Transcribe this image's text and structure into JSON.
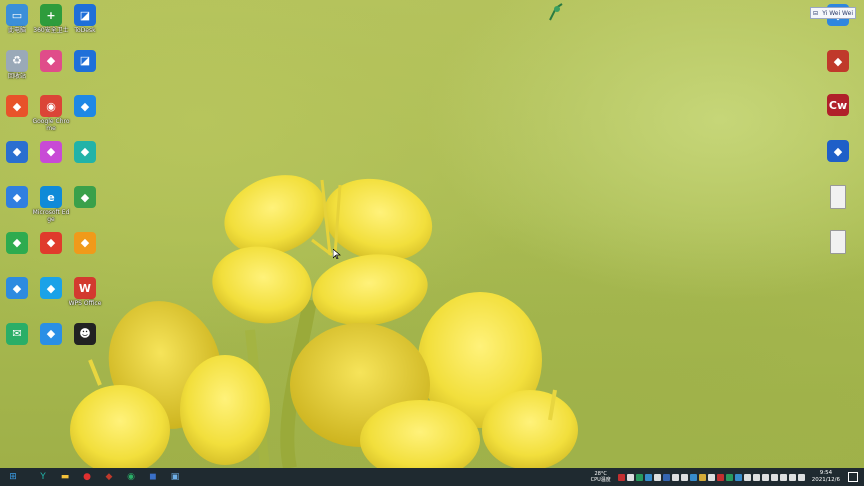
{
  "desktop_icons_left": [
    {
      "label": "此电脑",
      "icon": "computer-icon",
      "color": "#3b8fd9"
    },
    {
      "label": "360安全卫士",
      "icon": "360-guard-icon",
      "color": "#2e9c3c"
    },
    {
      "label": "ToDesk",
      "icon": "todesk-icon",
      "color": "#1e6fd9"
    },
    {
      "label": "回收站",
      "icon": "recycle-bin-icon",
      "color": "#9aa9b8"
    },
    {
      "label": "",
      "icon": "app-icon",
      "color": "#e04c8a"
    },
    {
      "label": "",
      "icon": "todesk-icon",
      "color": "#1e6fd9"
    },
    {
      "label": "",
      "icon": "app-icon",
      "color": "#e8532a"
    },
    {
      "label": "Google Chrome",
      "icon": "chrome-icon",
      "color": "#db4437"
    },
    {
      "label": "",
      "icon": "app-icon",
      "color": "#1e88e5"
    },
    {
      "label": "",
      "icon": "app-icon",
      "color": "#2a6fd0"
    },
    {
      "label": "",
      "icon": "app-icon",
      "color": "#c84ad6"
    },
    {
      "label": "",
      "icon": "app-icon",
      "color": "#22b3a8"
    },
    {
      "label": "",
      "icon": "app-icon",
      "color": "#2f7fe0"
    },
    {
      "label": "Microsoft Edge",
      "icon": "edge-icon",
      "color": "#0f8ad8"
    },
    {
      "label": "",
      "icon": "app-icon",
      "color": "#3aa04a"
    },
    {
      "label": "",
      "icon": "app-icon",
      "color": "#2eab4f"
    },
    {
      "label": "",
      "icon": "app-icon",
      "color": "#e03b2c"
    },
    {
      "label": "",
      "icon": "app-icon",
      "color": "#f09a1a"
    },
    {
      "label": "",
      "icon": "app-icon",
      "color": "#2d8be0"
    },
    {
      "label": "",
      "icon": "app-icon",
      "color": "#1aa2e8"
    },
    {
      "label": "WPS Office",
      "icon": "wps-icon",
      "color": "#d33a2f"
    },
    {
      "label": "",
      "icon": "wechat-icon",
      "color": "#2aae67"
    },
    {
      "label": "",
      "icon": "app-icon",
      "color": "#2a8fe6"
    },
    {
      "label": "",
      "icon": "qq-icon",
      "color": "#222222"
    }
  ],
  "desktop_icons_right": [
    {
      "label": "",
      "icon": "app-icon",
      "color": "#2e86de"
    },
    {
      "label": "",
      "icon": "app-icon",
      "color": "#c0392b"
    },
    {
      "label": "",
      "icon": "capswriter-icon",
      "color": "#b0202a"
    },
    {
      "label": "",
      "icon": "app-icon",
      "color": "#1f5fc8"
    },
    {
      "label": "",
      "icon": "file-icon",
      "color": "#f1f1f1"
    },
    {
      "label": "",
      "icon": "file-icon",
      "color": "#f1f1f1"
    }
  ],
  "tray_widget": {
    "label": "Yi Wei Wei",
    "icon": "widget-icon"
  },
  "taskbar": {
    "buttons": [
      {
        "name": "start-button",
        "glyph": "⊞",
        "color": "#3c9ee8"
      },
      {
        "name": "taskbar-app-1",
        "glyph": "Y",
        "color": "#22b3a8"
      },
      {
        "name": "taskbar-explorer",
        "glyph": "▬",
        "color": "#f3c13a"
      },
      {
        "name": "taskbar-app-2",
        "glyph": "●",
        "color": "#e03030"
      },
      {
        "name": "taskbar-app-3",
        "glyph": "◆",
        "color": "#c0392b"
      },
      {
        "name": "taskbar-wechat",
        "glyph": "◉",
        "color": "#2aae67"
      },
      {
        "name": "taskbar-app-4",
        "glyph": "◼",
        "color": "#3a70c8"
      },
      {
        "name": "taskbar-app-5",
        "glyph": "▣",
        "color": "#6fb0e8"
      }
    ],
    "weather_temp": "28°C",
    "weather_label": "CPU温度",
    "clock_time": "9:54",
    "clock_date": "2021/12/6",
    "tray_colors": [
      "#e03030",
      "#ffffff",
      "#2aae67",
      "#3c9ee8",
      "#ffffff",
      "#3a70c8",
      "#ffffff",
      "#ffffff",
      "#3c9ee8",
      "#f3c13a",
      "#ffffff",
      "#e03030",
      "#2aae67",
      "#3c9ee8",
      "#ffffff",
      "#ffffff",
      "#ffffff",
      "#ffffff",
      "#ffffff",
      "#ffffff",
      "#ffffff"
    ]
  }
}
